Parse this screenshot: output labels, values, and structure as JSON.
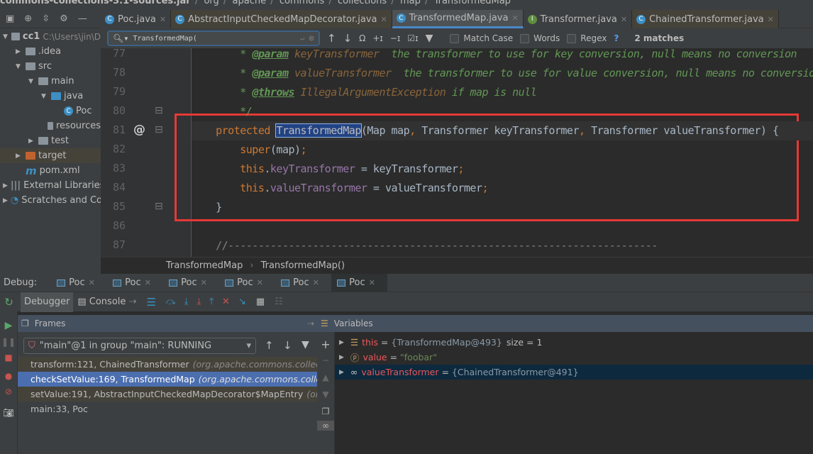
{
  "breadcrumb_top": [
    "commons-collections-3.1-sources.jar",
    "org",
    "apache",
    "commons",
    "collections",
    "map",
    "TransformedMap"
  ],
  "editor_tabs": [
    {
      "label": "Poc.java",
      "icon": "class-run-icon",
      "active": false
    },
    {
      "label": "AbstractInputCheckedMapDecorator.java",
      "icon": "class-locked-icon",
      "active": false
    },
    {
      "label": "TransformedMap.java",
      "icon": "class-locked-icon",
      "active": true
    },
    {
      "label": "Transformer.java",
      "icon": "interface-locked-icon",
      "active": false
    },
    {
      "label": "ChainedTransformer.java",
      "icon": "class-locked-icon",
      "active": false
    }
  ],
  "project_tree": [
    {
      "label": "cc1",
      "extra": "C:\\Users\\jin\\D",
      "depth": 0,
      "arrow": "▼",
      "icon": "module-folder-icon"
    },
    {
      "label": ".idea",
      "depth": 1,
      "arrow": "▶",
      "icon": "folder-icon"
    },
    {
      "label": "src",
      "depth": 1,
      "arrow": "▼",
      "icon": "folder-icon"
    },
    {
      "label": "main",
      "depth": 2,
      "arrow": "▼",
      "icon": "folder-icon"
    },
    {
      "label": "java",
      "depth": 3,
      "arrow": "▼",
      "icon": "source-folder-icon"
    },
    {
      "label": "Poc",
      "depth": 4,
      "arrow": "",
      "icon": "class-run-icon"
    },
    {
      "label": "resources",
      "depth": 3,
      "arrow": "",
      "icon": "resources-folder-icon"
    },
    {
      "label": "test",
      "depth": 2,
      "arrow": "▶",
      "icon": "folder-icon"
    },
    {
      "label": "target",
      "depth": 1,
      "arrow": "▶",
      "icon": "excluded-folder-icon"
    },
    {
      "label": "pom.xml",
      "depth": 1,
      "arrow": "",
      "icon": "maven-icon"
    },
    {
      "label": "External Libraries",
      "depth": 0,
      "arrow": "▶",
      "icon": "libraries-icon"
    },
    {
      "label": "Scratches and Consoles",
      "depth": 0,
      "arrow": "▶",
      "icon": "scratches-icon"
    }
  ],
  "search": {
    "query": "TransformedMap(",
    "match_case": "Match Case",
    "words": "Words",
    "regex": "Regex",
    "help": "?",
    "matches": "2 matches"
  },
  "code_lines": [
    {
      "n": "77",
      "tokens": [
        [
          "doc",
          "    * "
        ],
        [
          "tag",
          "@param"
        ],
        [
          "dp",
          " keyTransformer"
        ],
        [
          "doc",
          "  the transformer to use for key conversion, null means no conversion"
        ]
      ]
    },
    {
      "n": "78",
      "tokens": [
        [
          "doc",
          "    * "
        ],
        [
          "tag",
          "@param"
        ],
        [
          "dp",
          " valueTransformer"
        ],
        [
          "doc",
          "  the transformer to use for value conversion, null means no conversion"
        ]
      ]
    },
    {
      "n": "79",
      "tokens": [
        [
          "doc",
          "    * "
        ],
        [
          "tag",
          "@throws"
        ],
        [
          "dp",
          " IllegalArgumentException"
        ],
        [
          "doc",
          " if map is null"
        ]
      ]
    },
    {
      "n": "80",
      "tokens": [
        [
          "doc",
          "    */"
        ]
      ]
    },
    {
      "n": "81",
      "tokens": [
        [
          "k",
          "protected "
        ],
        [
          "hl",
          "TransformedMap"
        ],
        [
          "p",
          "(Map map"
        ],
        [
          "k",
          ", "
        ],
        [
          "p",
          "Transformer keyTransformer"
        ],
        [
          "k",
          ", "
        ],
        [
          "p",
          "Transformer valueTransformer) {"
        ]
      ]
    },
    {
      "n": "82",
      "tokens": [
        [
          "k",
          "    super"
        ],
        [
          "p",
          "(map)"
        ],
        [
          "k",
          ";"
        ]
      ]
    },
    {
      "n": "83",
      "tokens": [
        [
          "k",
          "    this"
        ],
        [
          "p",
          "."
        ],
        [
          "f",
          "keyTransformer"
        ],
        [
          "p",
          " = keyTransformer"
        ],
        [
          "k",
          ";"
        ]
      ]
    },
    {
      "n": "84",
      "tokens": [
        [
          "k",
          "    this"
        ],
        [
          "p",
          "."
        ],
        [
          "f",
          "valueTransformer"
        ],
        [
          "p",
          " = valueTransformer"
        ],
        [
          "k",
          ";"
        ]
      ]
    },
    {
      "n": "85",
      "tokens": [
        [
          "p",
          "}"
        ]
      ]
    },
    {
      "n": "86",
      "tokens": []
    },
    {
      "n": "87",
      "tokens": [
        [
          "cm",
          "//-----------------------------------------------------------------------"
        ]
      ]
    }
  ],
  "footer_breadcrumb": [
    "TransformedMap",
    "TransformedMap()"
  ],
  "debug": {
    "label": "Debug:",
    "sessions": [
      "Poc",
      "Poc",
      "Poc",
      "Poc",
      "Poc",
      "Poc"
    ],
    "tabs": {
      "debugger": "Debugger",
      "console": "Console"
    },
    "frames_title": "Frames",
    "variables_title": "Variables",
    "thread": "\"main\"@1 in group \"main\": RUNNING",
    "frames": [
      {
        "method": "transform:121, ChainedTransformer",
        "pkg": "(org.apache.commons.collections",
        "state": "lib"
      },
      {
        "method": "checkSetValue:169, TransformedMap",
        "pkg": "(org.apache.commons.collectio",
        "state": "selected"
      },
      {
        "method": "setValue:191, AbstractInputCheckedMapDecorator$MapEntry",
        "pkg": "(org.ap",
        "state": "lib"
      },
      {
        "method": "main:33, Poc",
        "pkg": "",
        "state": "normal"
      }
    ],
    "variables": [
      {
        "icon": "field-icon",
        "name": "this",
        "eq": " = ",
        "value": "{TransformedMap@493}",
        "extra": "size = 1",
        "kind": "obj"
      },
      {
        "icon": "parameter-icon",
        "name": "value",
        "eq": " = ",
        "value": "\"foobar\"",
        "extra": "",
        "kind": "str"
      },
      {
        "icon": "watch-icon",
        "name": "valueTransformer",
        "eq": " = ",
        "value": "{ChainedTransformer@491}",
        "extra": "",
        "kind": "obj"
      }
    ]
  },
  "colors": {
    "accent": "#4a88c7",
    "selection": "#4b6eaf",
    "highlight_box": "#e53935",
    "keyword": "#cc7832",
    "doc": "#629755"
  }
}
